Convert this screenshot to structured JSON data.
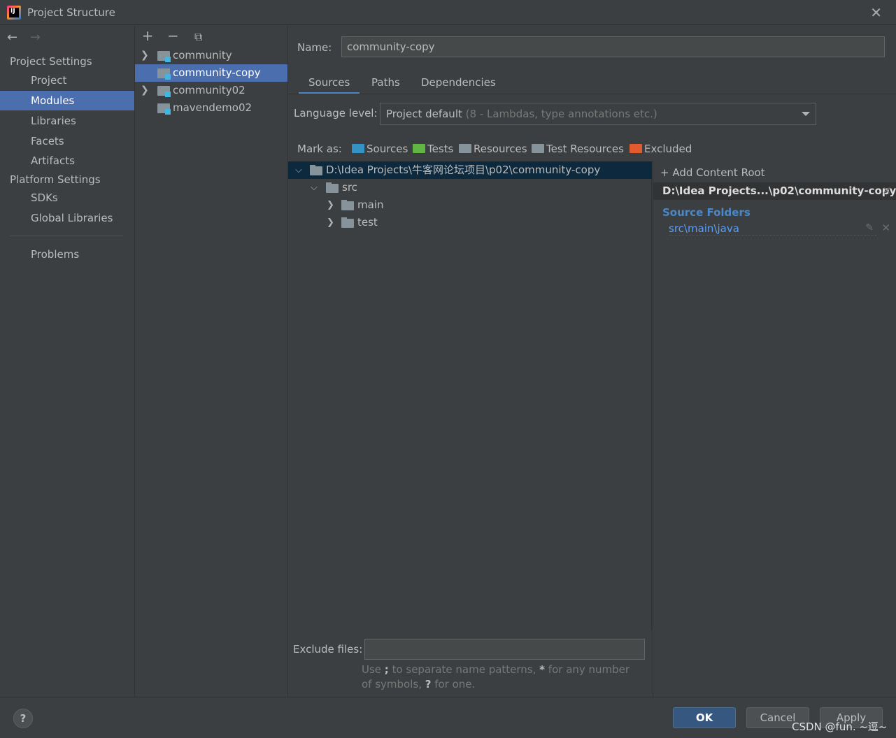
{
  "window": {
    "title": "Project Structure",
    "close_icon": "close-icon"
  },
  "nav": {
    "back_glyph": "←",
    "forward_glyph": "→",
    "project_settings_header": "Project Settings",
    "platform_settings_header": "Platform Settings",
    "items": {
      "project": "Project",
      "modules": "Modules",
      "libraries": "Libraries",
      "facets": "Facets",
      "artifacts": "Artifacts",
      "sdks": "SDKs",
      "global_libraries": "Global Libraries",
      "problems": "Problems"
    },
    "selected": "Modules"
  },
  "modules_toolbar": {
    "add": "+",
    "remove": "−",
    "copy": "⧉"
  },
  "modules": [
    {
      "name": "community",
      "expandable": true,
      "selected": false
    },
    {
      "name": "community-copy",
      "expandable": false,
      "selected": true
    },
    {
      "name": "community02",
      "expandable": true,
      "selected": false
    },
    {
      "name": "mavendemo02",
      "expandable": false,
      "selected": false
    }
  ],
  "details": {
    "name_label": "Name:",
    "name_value": "community-copy",
    "tabs": [
      "Sources",
      "Paths",
      "Dependencies"
    ],
    "active_tab": "Sources",
    "language_level_label": "Language level:",
    "language_level_value": "Project default",
    "language_level_hint": "(8 - Lambdas, type annotations etc.)",
    "mark_as_label": "Mark as:",
    "mark_as": [
      {
        "label": "Sources",
        "color": "#3592c4"
      },
      {
        "label": "Tests",
        "color": "#62b543"
      },
      {
        "label": "Resources",
        "color": "#87939a"
      },
      {
        "label": "Test Resources",
        "color": "#87939a"
      },
      {
        "label": "Excluded",
        "color": "#e05c2e"
      }
    ],
    "tree": {
      "root": "D:\\Idea Projects\\牛客网论坛项目\\p02\\community-copy",
      "src": "src",
      "main": "main",
      "test": "test"
    },
    "content_root": {
      "add_label": "Add Content Root",
      "path": "D:\\Idea Projects...\\p02\\community-copy",
      "source_folders_title": "Source Folders",
      "source_folders": [
        "src\\main\\java"
      ]
    },
    "exclude_files_label": "Exclude files:",
    "exclude_files_value": "",
    "exclude_hint_1": "Use ",
    "exclude_hint_semicolon": ";",
    "exclude_hint_2": " to separate name patterns, ",
    "exclude_hint_star": "*",
    "exclude_hint_3": " for any number of symbols, ",
    "exclude_hint_q": "?",
    "exclude_hint_4": " for one."
  },
  "buttons": {
    "help": "?",
    "ok": "OK",
    "cancel": "Cancel",
    "apply": "Apply"
  },
  "watermark": "CSDN @fun. ~逗~",
  "colors": {
    "accent": "#4b6eaf",
    "link": "#589df6",
    "ok_button": "#365880"
  }
}
